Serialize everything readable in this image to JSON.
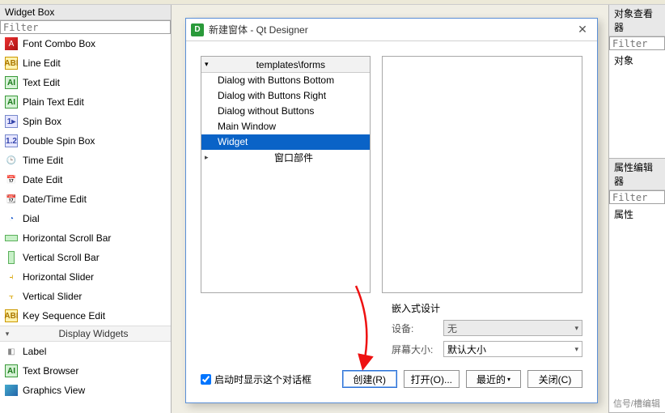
{
  "left": {
    "title": "Widget Box",
    "filter_placeholder": "Filter",
    "items": [
      "Font Combo Box",
      "Line Edit",
      "Text Edit",
      "Plain Text Edit",
      "Spin Box",
      "Double Spin Box",
      "Time Edit",
      "Date Edit",
      "Date/Time Edit",
      "Dial",
      "Horizontal Scroll Bar",
      "Vertical Scroll Bar",
      "Horizontal Slider",
      "Vertical Slider",
      "Key Sequence Edit"
    ],
    "group_label": "Display Widgets",
    "display_items": [
      "Label",
      "Text Browser",
      "Graphics View"
    ]
  },
  "right": {
    "panel1_title": "对象查看器",
    "panel1_filter": "Filter",
    "panel1_col": "对象",
    "panel2_title": "属性编辑器",
    "panel2_filter": "Filter",
    "panel2_col": "属性"
  },
  "dialog": {
    "title": "新建窗体 - Qt Designer",
    "tree_header": "templates\\forms",
    "tree_items": [
      "Dialog with Buttons Bottom",
      "Dialog with Buttons Right",
      "Dialog without Buttons",
      "Main Window",
      "Widget"
    ],
    "tree_selected_index": 4,
    "tree_group2": "窗口部件",
    "embedded_title": "嵌入式设计",
    "device_label": "设备:",
    "device_value": "无",
    "screen_label": "屏幕大小:",
    "screen_value": "默认大小",
    "show_on_start": "启动时显示这个对话框",
    "btn_create": "创建(R)",
    "btn_open": "打开(O)...",
    "btn_recent": "最近的",
    "btn_close": "关闭(C)"
  },
  "footer_text": "信号/槽编辑"
}
